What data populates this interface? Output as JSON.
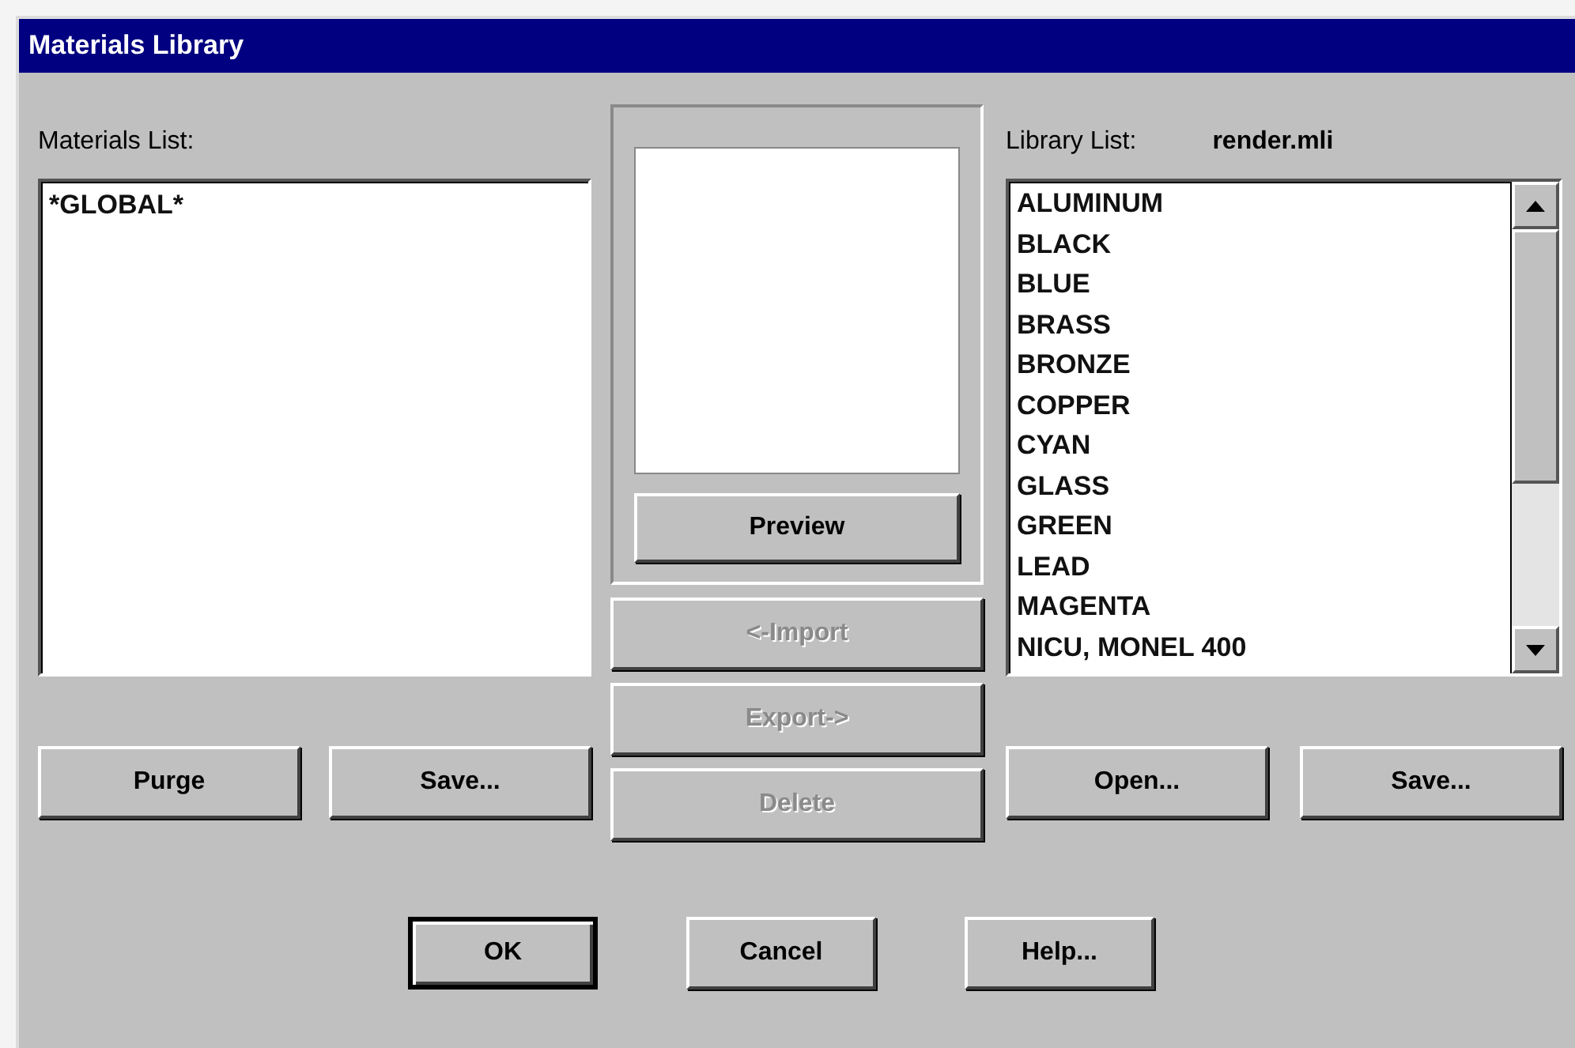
{
  "window": {
    "title": "Materials Library"
  },
  "materials": {
    "label": "Materials List:",
    "items": [
      {
        "name": "*GLOBAL*",
        "selected": false
      }
    ],
    "buttons": [
      {
        "label": "Purge",
        "disabled": false
      },
      {
        "label": "Save...",
        "disabled": false
      }
    ]
  },
  "preview": {
    "button": {
      "label": "Preview",
      "disabled": false
    }
  },
  "actions": [
    {
      "label": "<-Import",
      "disabled": true
    },
    {
      "label": "Export->",
      "disabled": true
    },
    {
      "label": "Delete",
      "disabled": true
    }
  ],
  "library": {
    "label": "Library List:",
    "file": "render.mli",
    "items": [
      {
        "name": "ALUMINUM",
        "selected": false
      },
      {
        "name": "BLACK",
        "selected": false
      },
      {
        "name": "BLUE",
        "selected": false
      },
      {
        "name": "BRASS",
        "selected": false
      },
      {
        "name": "BRONZE",
        "selected": false
      },
      {
        "name": "COPPER",
        "selected": false
      },
      {
        "name": "CYAN",
        "selected": false
      },
      {
        "name": "GLASS",
        "selected": false
      },
      {
        "name": "GREEN",
        "selected": false
      },
      {
        "name": "LEAD",
        "selected": false
      },
      {
        "name": "MAGENTA",
        "selected": false
      },
      {
        "name": "NICU, MONEL 400",
        "selected": false
      }
    ],
    "buttons": [
      {
        "label": "Open...",
        "disabled": false
      },
      {
        "label": "Save...",
        "disabled": false
      }
    ]
  },
  "dialog_buttons": [
    {
      "label": "OK",
      "default": true
    },
    {
      "label": "Cancel",
      "default": false
    },
    {
      "label": "Help...",
      "default": false
    }
  ]
}
